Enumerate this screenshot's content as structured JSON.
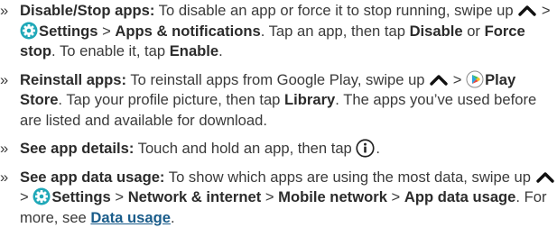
{
  "items": [
    {
      "marker": "»",
      "title": "Disable/Stop apps:",
      "t1": " To disable an app or force it to stop running, swipe up ",
      "sep1": " > ",
      "settings": "Settings",
      "sep2": " > ",
      "apps_notifs": "Apps & notifications",
      "t2": ". Tap an app, then tap ",
      "disable": "Disable",
      "t3": " or ",
      "force_stop": "Force stop",
      "t4": ". To enable it, tap ",
      "enable": "Enable",
      "t5": "."
    },
    {
      "marker": "»",
      "title": "Reinstall apps:",
      "t1": " To reinstall apps from Google Play, swipe up ",
      "sep1": " > ",
      "play_store": "Play Store",
      "t2": ". Tap your profile picture, then tap ",
      "library": "Library",
      "t3": ". The apps you’ve used before are listed and available for download."
    },
    {
      "marker": "»",
      "title": "See app details:",
      "t1": " Touch and hold an app, then tap ",
      "t2": "."
    },
    {
      "marker": "»",
      "title": "See app data usage:",
      "t1": " To show which apps are using the most data, swipe up ",
      "sep1": " > ",
      "settings": "Settings",
      "sep2": " > ",
      "network": "Network & internet",
      "sep3": " > ",
      "mobile": "Mobile network",
      "sep4": " > ",
      "app_data": "App data usage",
      "t2": ". For more, see ",
      "data_usage_link": "Data usage",
      "t3": "."
    }
  ],
  "icons": {
    "up": "chevron-up-icon",
    "settings": "settings-gear-icon",
    "play_store": "play-store-icon",
    "info": "info-icon"
  },
  "colors": {
    "text": "#3a3a3a",
    "bold": "#2b2b2b",
    "link": "#1a5c8a",
    "settings_icon": "#1fa8b8",
    "info_icon": "#3a3a3a"
  }
}
